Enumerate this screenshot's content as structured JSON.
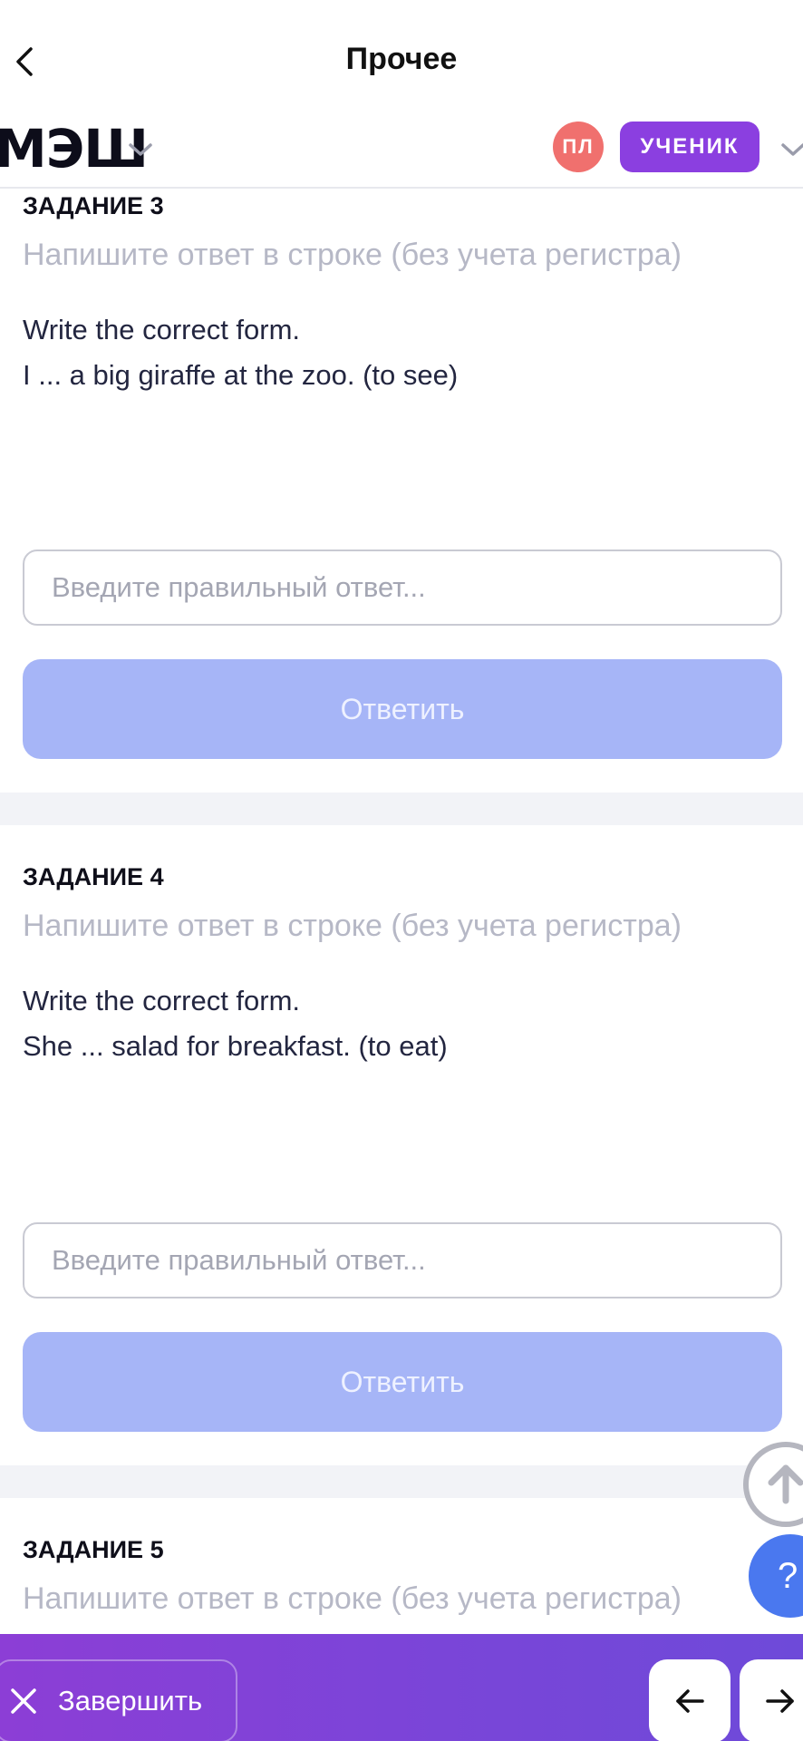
{
  "header": {
    "title": "Прочее"
  },
  "appbar": {
    "logo": "МЭШ",
    "avatar_initials": "ПЛ",
    "role": "УЧЕНИК"
  },
  "tasks": [
    {
      "title": "ЗАДАНИЕ 3",
      "hint": "Напишите ответ в строке (без учета регистра)",
      "instruction": "Write the correct form.",
      "sentence": "I ... a big giraffe at the zoo. (to see)",
      "input_placeholder": "Введите правильный ответ...",
      "submit_label": "Ответить"
    },
    {
      "title": "ЗАДАНИЕ 4",
      "hint": "Напишите ответ в строке (без учета регистра)",
      "instruction": "Write the correct form.",
      "sentence": "She ... salad for breakfast. (to eat)",
      "input_placeholder": "Введите правильный ответ...",
      "submit_label": "Ответить"
    },
    {
      "title": "ЗАДАНИЕ 5",
      "hint": "Напишите ответ в строке (без учета регистра)"
    }
  ],
  "fab": {
    "help_label": "?"
  },
  "bottombar": {
    "finish_label": "Завершить"
  },
  "colors": {
    "accent": "#8b3fe0",
    "avatar": "#f0706e",
    "button_disabled": "#a6b5f7",
    "help": "#4a78ef"
  },
  "icons": [
    "back-arrow-icon",
    "chevron-down-icon",
    "arrow-up-icon",
    "close-icon",
    "arrow-left-icon",
    "arrow-right-icon"
  ]
}
